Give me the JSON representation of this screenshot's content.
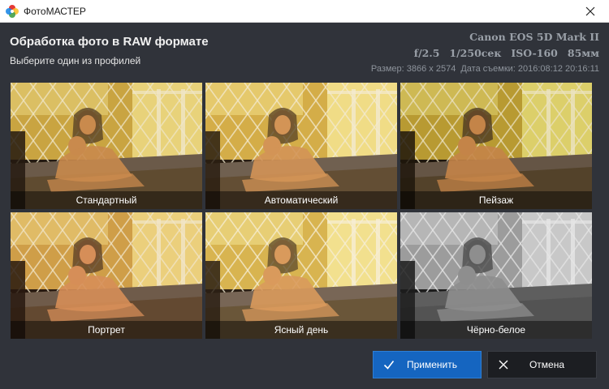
{
  "window": {
    "title": "ФотоМАСТЕР"
  },
  "header": {
    "title": "Обработка фото в RAW формате",
    "subtitle": "Выберите один из профилей",
    "camera_model": "Canon EOS 5D Mark II",
    "aperture": "f/2.5",
    "shutter": "1/250сек",
    "iso": "ISO-160",
    "focal": "85мм",
    "size_label": "Размер: 3866 x 2574",
    "date_label": "Дата съемки: 2016:08:12 20:16:11"
  },
  "profiles": [
    {
      "label": "Стандартный",
      "style": "standard"
    },
    {
      "label": "Автоматический",
      "style": "auto"
    },
    {
      "label": "Пейзаж",
      "style": "landscape"
    },
    {
      "label": "Портрет",
      "style": "portrait"
    },
    {
      "label": "Ясный день",
      "style": "clearday"
    },
    {
      "label": "Чёрно-белое",
      "style": "bw"
    }
  ],
  "buttons": {
    "apply": "Применить",
    "cancel": "Отмена"
  },
  "colors": {
    "accent": "#1565c0",
    "background": "#30333a"
  }
}
